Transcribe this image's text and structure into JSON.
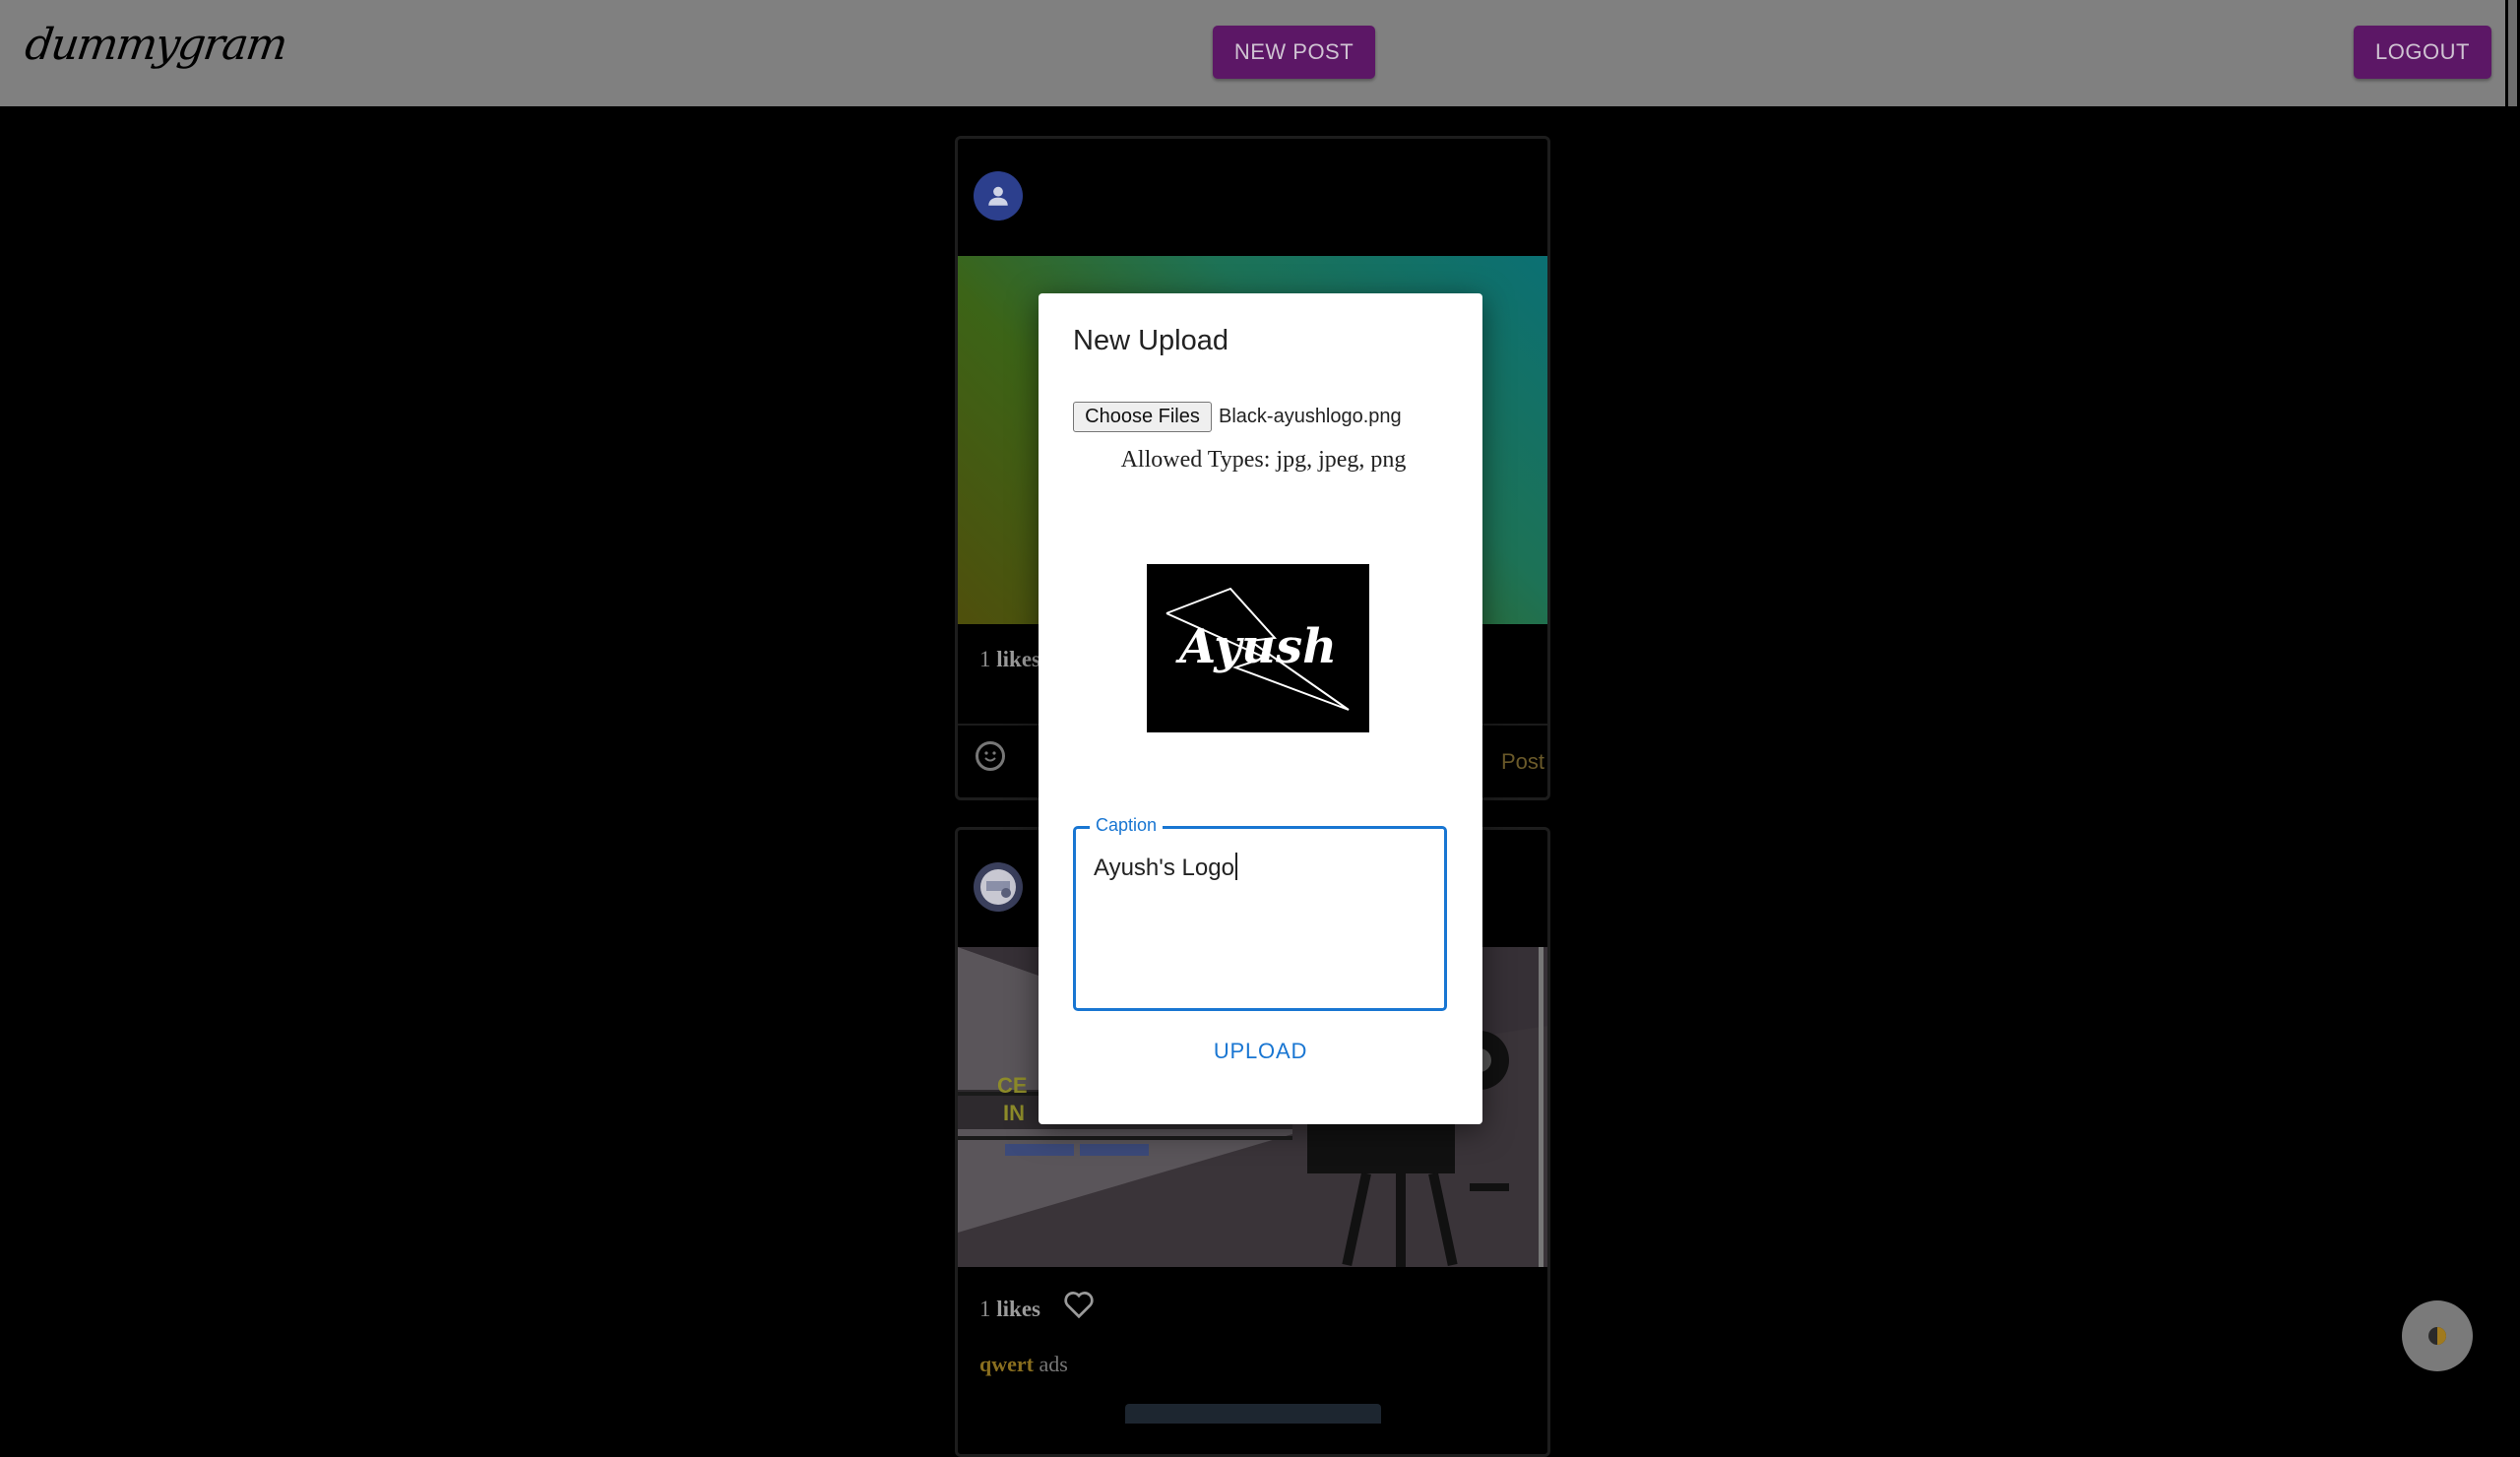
{
  "header": {
    "logo_text": "dummygram",
    "new_post_label": "NEW POST",
    "logout_label": "LOGOUT"
  },
  "feed": {
    "posts": [
      {
        "likes_count": "1",
        "likes_label": "likes",
        "post_action_label": "Post"
      },
      {
        "likes_count": "1",
        "likes_label": "likes",
        "comment_user": "qwert",
        "comment_text": "ads"
      }
    ]
  },
  "modal": {
    "title": "New Upload",
    "choose_files_label": "Choose Files",
    "file_name": "Black-ayushlogo.png",
    "allowed_types": "Allowed Types: jpg, jpeg, png",
    "preview_text": "Ayush",
    "caption_label": "Caption",
    "caption_value": "Ayush's Logo",
    "upload_label": "UPLOAD"
  },
  "icons": {
    "avatar": "person-icon",
    "emoji": "smiley-icon",
    "like": "heart-icon",
    "theme": "half-circle-icon"
  },
  "colors": {
    "accent_purple": "#5c1766",
    "primary_blue": "#1976d2"
  }
}
